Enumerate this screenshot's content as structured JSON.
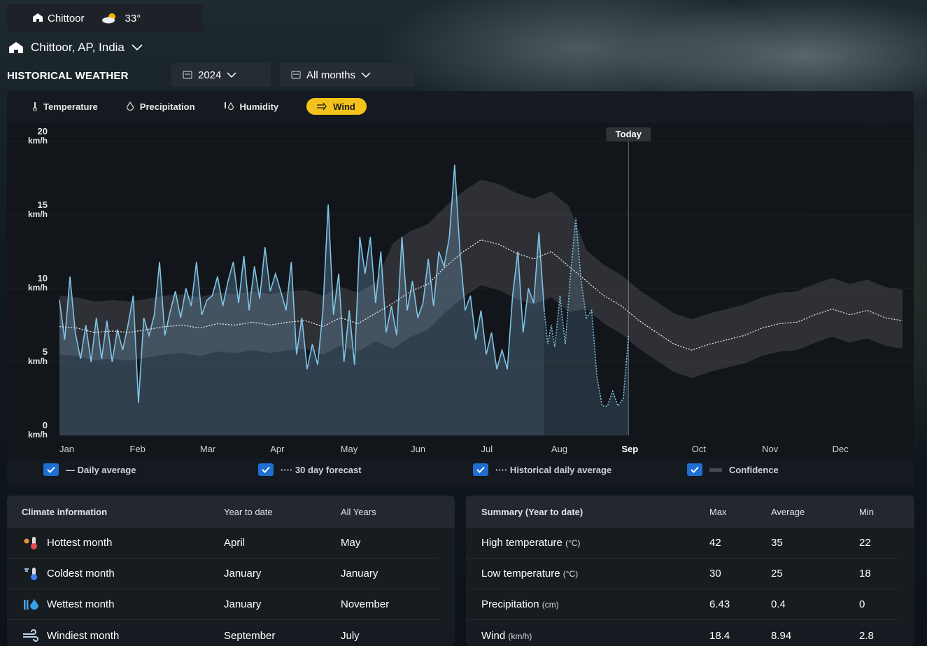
{
  "topbar": {
    "location": "Chittoor",
    "temperature": "33°"
  },
  "header": {
    "city": "Chittoor, AP, India",
    "section_title": "HISTORICAL WEATHER",
    "year": "2024",
    "months": "All months"
  },
  "tabs": [
    {
      "label": "Temperature",
      "icon": "thermometer-icon"
    },
    {
      "label": "Precipitation",
      "icon": "droplet-icon"
    },
    {
      "label": "Humidity",
      "icon": "humidity-icon"
    },
    {
      "label": "Wind",
      "icon": "wind-icon",
      "active": true
    }
  ],
  "colors": {
    "accent": "#f4c21a",
    "checkbox": "#1e6fd1",
    "daily": "#7fc4e6",
    "historical": "#e8e8e8"
  },
  "chart_data": {
    "type": "line",
    "today_label": "Today",
    "y_ticks": [
      {
        "value": "0",
        "unit": "km/h"
      },
      {
        "value": "5",
        "unit": "km/h"
      },
      {
        "value": "10",
        "unit": "km/h"
      },
      {
        "value": "15",
        "unit": "km/h"
      },
      {
        "value": "20",
        "unit": "km/h"
      }
    ],
    "ylim": [
      0,
      20
    ],
    "months": [
      "Jan",
      "Feb",
      "Mar",
      "Apr",
      "May",
      "Jun",
      "Jul",
      "Aug",
      "Sep",
      "Oct",
      "Nov",
      "Dec"
    ],
    "today_month_index": 8,
    "daily_average": [
      [
        0,
        9.2
      ],
      [
        0.3,
        6.5
      ],
      [
        0.6,
        10.8
      ],
      [
        0.9,
        7
      ],
      [
        1.2,
        5.2
      ],
      [
        1.5,
        7.5
      ],
      [
        1.8,
        5
      ],
      [
        2.1,
        8
      ],
      [
        2.4,
        5.2
      ],
      [
        2.7,
        7.8
      ],
      [
        3.0,
        5
      ],
      [
        3.3,
        7.2
      ],
      [
        3.6,
        5.8
      ],
      [
        3.9,
        7.5
      ],
      [
        4.2,
        9.5
      ],
      [
        4.5,
        2.2
      ],
      [
        4.8,
        8
      ],
      [
        5.1,
        6.8
      ],
      [
        5.4,
        8.2
      ],
      [
        5.7,
        11.8
      ],
      [
        6.0,
        6.8
      ],
      [
        6.3,
        8.4
      ],
      [
        6.6,
        9.8
      ],
      [
        6.9,
        8
      ],
      [
        7.2,
        10
      ],
      [
        7.5,
        8.8
      ],
      [
        7.8,
        11.8
      ],
      [
        8.1,
        8.2
      ],
      [
        8.4,
        9.2
      ],
      [
        8.7,
        9.5
      ],
      [
        9.0,
        10.8
      ],
      [
        9.3,
        8.8
      ],
      [
        9.6,
        10.5
      ],
      [
        9.9,
        11.8
      ],
      [
        10.2,
        9
      ],
      [
        10.5,
        12.2
      ],
      [
        10.8,
        8.5
      ],
      [
        11.1,
        11.5
      ],
      [
        11.4,
        9.3
      ],
      [
        11.7,
        12.8
      ],
      [
        12.0,
        9.8
      ],
      [
        12.3,
        11
      ],
      [
        12.6,
        9.8
      ],
      [
        12.9,
        8.5
      ],
      [
        13.2,
        11.8
      ],
      [
        13.5,
        5.5
      ],
      [
        13.8,
        8
      ],
      [
        14.1,
        4.5
      ],
      [
        14.4,
        6.2
      ],
      [
        14.7,
        4.8
      ],
      [
        15.0,
        8.5
      ],
      [
        15.3,
        15.7
      ],
      [
        15.6,
        8.2
      ],
      [
        15.9,
        11
      ],
      [
        16.2,
        5
      ],
      [
        16.5,
        8.5
      ],
      [
        16.8,
        4.8
      ],
      [
        17.1,
        13.5
      ],
      [
        17.4,
        11
      ],
      [
        17.7,
        13.5
      ],
      [
        18.0,
        9
      ],
      [
        18.3,
        12.5
      ],
      [
        18.6,
        7
      ],
      [
        18.9,
        8.8
      ],
      [
        19.2,
        6.8
      ],
      [
        19.5,
        13.5
      ],
      [
        19.8,
        8.5
      ],
      [
        20.1,
        10.5
      ],
      [
        20.4,
        8
      ],
      [
        20.7,
        9
      ],
      [
        21.0,
        12
      ],
      [
        21.3,
        8.8
      ],
      [
        21.6,
        12.5
      ],
      [
        21.9,
        11.5
      ],
      [
        22.2,
        13.5
      ],
      [
        22.5,
        18.4
      ],
      [
        22.8,
        12.5
      ],
      [
        23.1,
        8.5
      ],
      [
        23.4,
        9.5
      ],
      [
        23.7,
        6.5
      ],
      [
        24.0,
        8.5
      ],
      [
        24.3,
        5.5
      ],
      [
        24.6,
        7
      ],
      [
        24.9,
        4.5
      ],
      [
        25.2,
        5.8
      ],
      [
        25.5,
        4.5
      ],
      [
        25.8,
        9.5
      ],
      [
        26.1,
        12.5
      ],
      [
        26.4,
        7
      ],
      [
        26.7,
        10
      ],
      [
        27.0,
        9
      ],
      [
        27.3,
        13.8
      ],
      [
        27.6,
        8.5
      ]
    ],
    "forecast": [
      [
        27.6,
        8.5
      ],
      [
        27.8,
        6.2
      ],
      [
        28.0,
        7.5
      ],
      [
        28.2,
        6
      ],
      [
        28.5,
        9.5
      ],
      [
        28.8,
        6.2
      ],
      [
        29.1,
        11
      ],
      [
        29.4,
        14.8
      ],
      [
        29.7,
        10.5
      ],
      [
        30.0,
        8
      ],
      [
        30.3,
        8.5
      ],
      [
        30.6,
        4
      ],
      [
        30.9,
        2
      ],
      [
        31.2,
        2
      ],
      [
        31.5,
        3
      ],
      [
        31.8,
        2
      ],
      [
        32.1,
        2.5
      ],
      [
        32.4,
        6.8
      ]
    ],
    "historical_daily_average": [
      [
        0,
        7.4
      ],
      [
        1,
        7.3
      ],
      [
        2,
        7.0
      ],
      [
        3,
        7.1
      ],
      [
        4,
        7.0
      ],
      [
        5,
        7.2
      ],
      [
        6,
        7.4
      ],
      [
        7,
        7.5
      ],
      [
        8,
        7.3
      ],
      [
        9,
        7.6
      ],
      [
        10,
        7.5
      ],
      [
        11,
        7.7
      ],
      [
        12,
        7.5
      ],
      [
        13,
        7.7
      ],
      [
        14,
        7.8
      ],
      [
        15,
        7.4
      ],
      [
        16,
        8.0
      ],
      [
        17,
        7.6
      ],
      [
        18,
        8.3
      ],
      [
        19,
        9.0
      ],
      [
        20,
        9.8
      ],
      [
        21,
        10.3
      ],
      [
        22,
        11.5
      ],
      [
        23,
        12.5
      ],
      [
        24,
        13.3
      ],
      [
        25,
        13.0
      ],
      [
        26,
        12.4
      ],
      [
        27,
        12.0
      ],
      [
        28,
        12.5
      ],
      [
        29,
        11.5
      ],
      [
        30,
        10.5
      ],
      [
        31,
        9.5
      ],
      [
        32,
        8.8
      ],
      [
        33,
        7.8
      ],
      [
        34,
        7.0
      ],
      [
        35,
        6.2
      ],
      [
        36,
        5.8
      ],
      [
        37,
        6.2
      ],
      [
        38,
        6.5
      ],
      [
        39,
        6.8
      ],
      [
        40,
        7.3
      ],
      [
        41,
        7.6
      ],
      [
        42,
        7.7
      ],
      [
        43,
        8.2
      ],
      [
        44,
        8.6
      ],
      [
        45,
        8.2
      ],
      [
        46,
        8.5
      ],
      [
        47,
        8.0
      ],
      [
        48,
        7.8
      ]
    ],
    "series_labels": {
      "daily": "— Daily average",
      "forecast": "···· 30 day forecast",
      "historical": "···· Historical daily average",
      "confidence": "Confidence"
    }
  },
  "climate_info": {
    "headers": [
      "Climate information",
      "Year to date",
      "All Years"
    ],
    "rows": [
      {
        "label": "Hottest month",
        "ytd": "April",
        "all": "May",
        "icon": "hot-thermometer-icon"
      },
      {
        "label": "Coldest month",
        "ytd": "January",
        "all": "January",
        "icon": "cold-thermometer-icon"
      },
      {
        "label": "Wettest month",
        "ytd": "January",
        "all": "November",
        "icon": "rain-drop-icon"
      },
      {
        "label": "Windiest month",
        "ytd": "September",
        "all": "July",
        "icon": "wind-icon"
      }
    ]
  },
  "summary": {
    "headers": [
      "Summary (Year to date)",
      "Max",
      "Average",
      "Min"
    ],
    "rows": [
      {
        "label": "High temperature",
        "unit": "(°C)",
        "max": "42",
        "avg": "35",
        "min": "22"
      },
      {
        "label": "Low temperature",
        "unit": "(°C)",
        "max": "30",
        "avg": "25",
        "min": "18"
      },
      {
        "label": "Precipitation",
        "unit": "(cm)",
        "max": "6.43",
        "avg": "0.4",
        "min": "0"
      },
      {
        "label": "Wind",
        "unit": "(km/h)",
        "max": "18.4",
        "avg": "8.94",
        "min": "2.8"
      }
    ]
  }
}
